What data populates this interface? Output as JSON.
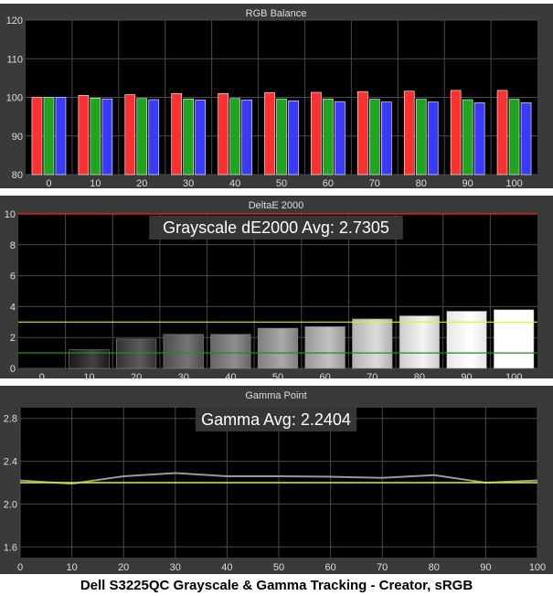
{
  "caption": "Dell S3225QC Grayscale & Gamma Tracking - Creator, sRGB",
  "colors": {
    "panel_bg": "#3a3a3a",
    "plot_bg": "#000000",
    "grid": "#4a4a4a",
    "text": "#dcdcdc",
    "red": "#ff3030",
    "green": "#1fa51f",
    "blue": "#3a3aff",
    "threshold_red": "#ff2020",
    "threshold_yellow": "#f0f000",
    "threshold_green": "#1f8f1f",
    "gamma_line": "#9a9a9a",
    "gamma_target": "#f0f000"
  },
  "chart_data": [
    {
      "type": "bar",
      "title": "RGB Balance",
      "categories": [
        "0",
        "10",
        "20",
        "30",
        "40",
        "50",
        "60",
        "70",
        "80",
        "90",
        "100"
      ],
      "ylim": [
        80,
        120
      ],
      "yticks": [
        80,
        90,
        100,
        110,
        120
      ],
      "grid": true,
      "series": [
        {
          "values": [
            100,
            100.5,
            100.7,
            101,
            101,
            101.2,
            101.3,
            101.5,
            101.6,
            101.8,
            101.8
          ],
          "color": "red"
        },
        {
          "values": [
            100,
            99.8,
            99.7,
            99.6,
            99.7,
            99.6,
            99.6,
            99.5,
            99.5,
            99.4,
            99.5
          ],
          "color": "green"
        },
        {
          "values": [
            100,
            99.6,
            99.4,
            99.3,
            99.3,
            99.1,
            98.9,
            98.8,
            98.8,
            98.6,
            98.6
          ],
          "color": "blue"
        }
      ]
    },
    {
      "type": "bar",
      "title": "DeltaE 2000",
      "annotation": "Grayscale dE2000 Avg: 2.7305",
      "categories": [
        "0",
        "10",
        "20",
        "30",
        "40",
        "50",
        "60",
        "70",
        "80",
        "90",
        "100"
      ],
      "ylim": [
        0,
        10
      ],
      "yticks": [
        0,
        2,
        4,
        6,
        8,
        10
      ],
      "grid": true,
      "values": [
        0,
        1.2,
        1.9,
        2.2,
        2.2,
        2.6,
        2.7,
        3.2,
        3.4,
        3.7,
        3.8
      ],
      "thresholds": [
        {
          "value": 10,
          "color": "threshold_red"
        },
        {
          "value": 3,
          "color": "threshold_yellow"
        },
        {
          "value": 1,
          "color": "threshold_green"
        }
      ]
    },
    {
      "type": "line",
      "title": "Gamma Point",
      "annotation": "Gamma Avg: 2.2404",
      "x": [
        0,
        10,
        20,
        30,
        40,
        50,
        60,
        70,
        80,
        90,
        100
      ],
      "xticks": [
        0,
        10,
        20,
        30,
        40,
        50,
        60,
        70,
        80,
        90,
        100
      ],
      "ylim": [
        1.5,
        2.9
      ],
      "yticks": [
        1.6,
        2,
        2.4,
        2.8
      ],
      "grid": true,
      "series": [
        {
          "values": [
            2.22,
            2.19,
            2.26,
            2.29,
            2.26,
            2.26,
            2.255,
            2.245,
            2.27,
            2.2,
            2.22
          ],
          "color": "gamma_line"
        },
        {
          "values": [
            2.2,
            2.2,
            2.2,
            2.2,
            2.2,
            2.2,
            2.2,
            2.2,
            2.2,
            2.2,
            2.2
          ],
          "color": "gamma_target"
        }
      ]
    }
  ]
}
